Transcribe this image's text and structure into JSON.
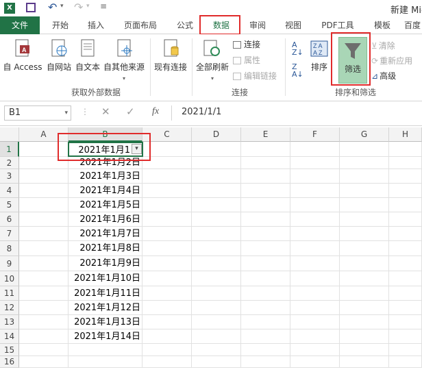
{
  "titlebar": {
    "title": "新建 Mic"
  },
  "tabs": [
    {
      "label": "文件"
    },
    {
      "label": "开始"
    },
    {
      "label": "插入"
    },
    {
      "label": "页面布局"
    },
    {
      "label": "公式"
    },
    {
      "label": "数据"
    },
    {
      "label": "审阅"
    },
    {
      "label": "视图"
    },
    {
      "label": "PDF工具"
    },
    {
      "label": "模板"
    },
    {
      "label": "百度"
    }
  ],
  "ribbon": {
    "get_external": {
      "access": "自 Access",
      "web": "自网站",
      "text": "自文本",
      "other": "自其他来源",
      "group_label": "获取外部数据"
    },
    "existing": "现有连接",
    "connections": {
      "refresh_all": "全部刷新",
      "connect": "连接",
      "properties": "属性",
      "edit_links": "编辑链接",
      "group_label": "连接"
    },
    "sort_filter": {
      "sort": "排序",
      "filter": "筛选",
      "clear": "清除",
      "reapply": "重新应用",
      "advanced": "高级",
      "group_label": "排序和筛选"
    }
  },
  "formula_bar": {
    "name_box": "B1",
    "fx": "fx",
    "value": "2021/1/1"
  },
  "columns": [
    "A",
    "B",
    "C",
    "D",
    "E",
    "F",
    "G",
    "H"
  ],
  "rows": [
    "1",
    "2",
    "3",
    "4",
    "5",
    "6",
    "7",
    "8",
    "9",
    "10",
    "11",
    "12",
    "13",
    "14",
    "15",
    "16"
  ],
  "column_b": [
    "2021年1月1",
    "2021年1月2日",
    "2021年1月3日",
    "2021年1月4日",
    "2021年1月5日",
    "2021年1月6日",
    "2021年1月7日",
    "2021年1月8日",
    "2021年1月9日",
    "2021年1月10日",
    "2021年1月11日",
    "2021年1月12日",
    "2021年1月13日",
    "2021年1月14日"
  ],
  "colors": {
    "excel_green": "#217346",
    "highlight_red": "#e02b2b",
    "filter_active": "#a9d6b6"
  }
}
